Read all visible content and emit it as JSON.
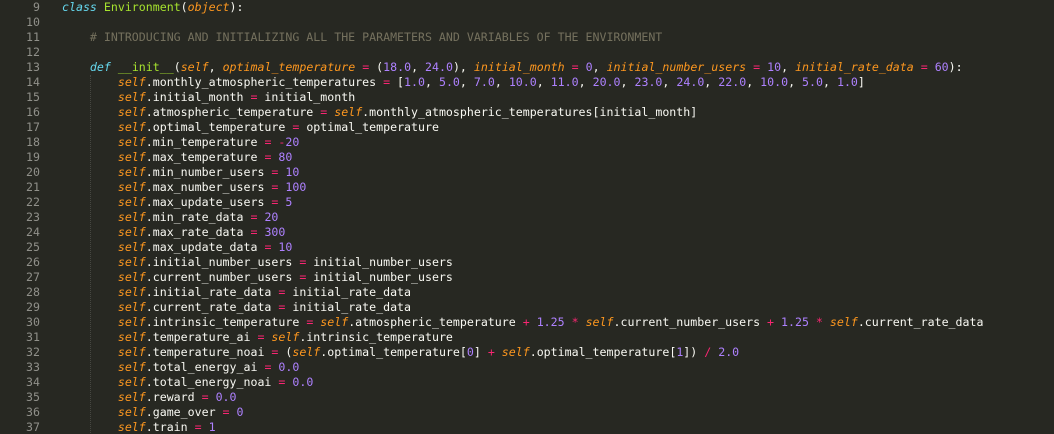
{
  "editor": {
    "first_line_number": 9,
    "lines": [
      {
        "n": "9",
        "tokens": [
          [
            "kw-i",
            "class"
          ],
          [
            "plain",
            " "
          ],
          [
            "cls",
            "Environment"
          ],
          [
            "plain",
            "("
          ],
          [
            "param",
            "object"
          ],
          [
            "plain",
            "):"
          ]
        ]
      },
      {
        "n": "10",
        "tokens": []
      },
      {
        "n": "11",
        "tokens": [
          [
            "plain",
            "    "
          ],
          [
            "cmt",
            "# INTRODUCING AND INITIALIZING ALL THE PARAMETERS AND VARIABLES OF THE ENVIRONMENT"
          ]
        ]
      },
      {
        "n": "12",
        "tokens": []
      },
      {
        "n": "13",
        "tokens": [
          [
            "plain",
            "    "
          ],
          [
            "kw-i",
            "def"
          ],
          [
            "plain",
            " "
          ],
          [
            "fn",
            "__init__"
          ],
          [
            "plain",
            "("
          ],
          [
            "param",
            "self"
          ],
          [
            "plain",
            ", "
          ],
          [
            "param",
            "optimal_temperature"
          ],
          [
            "plain",
            " "
          ],
          [
            "op",
            "="
          ],
          [
            "plain",
            " ("
          ],
          [
            "num",
            "18.0"
          ],
          [
            "plain",
            ", "
          ],
          [
            "num",
            "24.0"
          ],
          [
            "plain",
            "), "
          ],
          [
            "param",
            "initial_month"
          ],
          [
            "plain",
            " "
          ],
          [
            "op",
            "="
          ],
          [
            "plain",
            " "
          ],
          [
            "num",
            "0"
          ],
          [
            "plain",
            ", "
          ],
          [
            "param",
            "initial_number_users"
          ],
          [
            "plain",
            " "
          ],
          [
            "op",
            "="
          ],
          [
            "plain",
            " "
          ],
          [
            "num",
            "10"
          ],
          [
            "plain",
            ", "
          ],
          [
            "param",
            "initial_rate_data"
          ],
          [
            "plain",
            " "
          ],
          [
            "op",
            "="
          ],
          [
            "plain",
            " "
          ],
          [
            "num",
            "60"
          ],
          [
            "plain",
            "):"
          ]
        ]
      },
      {
        "n": "14",
        "tokens": [
          [
            "plain",
            "        "
          ],
          [
            "self",
            "self"
          ],
          [
            "plain",
            ".monthly_atmospheric_temperatures "
          ],
          [
            "op",
            "="
          ],
          [
            "plain",
            " ["
          ],
          [
            "num",
            "1.0"
          ],
          [
            "plain",
            ", "
          ],
          [
            "num",
            "5.0"
          ],
          [
            "plain",
            ", "
          ],
          [
            "num",
            "7.0"
          ],
          [
            "plain",
            ", "
          ],
          [
            "num",
            "10.0"
          ],
          [
            "plain",
            ", "
          ],
          [
            "num",
            "11.0"
          ],
          [
            "plain",
            ", "
          ],
          [
            "num",
            "20.0"
          ],
          [
            "plain",
            ", "
          ],
          [
            "num",
            "23.0"
          ],
          [
            "plain",
            ", "
          ],
          [
            "num",
            "24.0"
          ],
          [
            "plain",
            ", "
          ],
          [
            "num",
            "22.0"
          ],
          [
            "plain",
            ", "
          ],
          [
            "num",
            "10.0"
          ],
          [
            "plain",
            ", "
          ],
          [
            "num",
            "5.0"
          ],
          [
            "plain",
            ", "
          ],
          [
            "num",
            "1.0"
          ],
          [
            "plain",
            "]"
          ]
        ]
      },
      {
        "n": "15",
        "tokens": [
          [
            "plain",
            "        "
          ],
          [
            "self",
            "self"
          ],
          [
            "plain",
            ".initial_month "
          ],
          [
            "op",
            "="
          ],
          [
            "plain",
            " initial_month"
          ]
        ]
      },
      {
        "n": "16",
        "tokens": [
          [
            "plain",
            "        "
          ],
          [
            "self",
            "self"
          ],
          [
            "plain",
            ".atmospheric_temperature "
          ],
          [
            "op",
            "="
          ],
          [
            "plain",
            " "
          ],
          [
            "self",
            "self"
          ],
          [
            "plain",
            ".monthly_atmospheric_temperatures[initial_month]"
          ]
        ]
      },
      {
        "n": "17",
        "tokens": [
          [
            "plain",
            "        "
          ],
          [
            "self",
            "self"
          ],
          [
            "plain",
            ".optimal_temperature "
          ],
          [
            "op",
            "="
          ],
          [
            "plain",
            " optimal_temperature"
          ]
        ]
      },
      {
        "n": "18",
        "tokens": [
          [
            "plain",
            "        "
          ],
          [
            "self",
            "self"
          ],
          [
            "plain",
            ".min_temperature "
          ],
          [
            "op",
            "="
          ],
          [
            "plain",
            " "
          ],
          [
            "op",
            "-"
          ],
          [
            "num",
            "20"
          ]
        ]
      },
      {
        "n": "19",
        "tokens": [
          [
            "plain",
            "        "
          ],
          [
            "self",
            "self"
          ],
          [
            "plain",
            ".max_temperature "
          ],
          [
            "op",
            "="
          ],
          [
            "plain",
            " "
          ],
          [
            "num",
            "80"
          ]
        ]
      },
      {
        "n": "20",
        "tokens": [
          [
            "plain",
            "        "
          ],
          [
            "self",
            "self"
          ],
          [
            "plain",
            ".min_number_users "
          ],
          [
            "op",
            "="
          ],
          [
            "plain",
            " "
          ],
          [
            "num",
            "10"
          ]
        ]
      },
      {
        "n": "21",
        "tokens": [
          [
            "plain",
            "        "
          ],
          [
            "self",
            "self"
          ],
          [
            "plain",
            ".max_number_users "
          ],
          [
            "op",
            "="
          ],
          [
            "plain",
            " "
          ],
          [
            "num",
            "100"
          ]
        ]
      },
      {
        "n": "22",
        "tokens": [
          [
            "plain",
            "        "
          ],
          [
            "self",
            "self"
          ],
          [
            "plain",
            ".max_update_users "
          ],
          [
            "op",
            "="
          ],
          [
            "plain",
            " "
          ],
          [
            "num",
            "5"
          ]
        ]
      },
      {
        "n": "23",
        "tokens": [
          [
            "plain",
            "        "
          ],
          [
            "self",
            "self"
          ],
          [
            "plain",
            ".min_rate_data "
          ],
          [
            "op",
            "="
          ],
          [
            "plain",
            " "
          ],
          [
            "num",
            "20"
          ]
        ]
      },
      {
        "n": "24",
        "tokens": [
          [
            "plain",
            "        "
          ],
          [
            "self",
            "self"
          ],
          [
            "plain",
            ".max_rate_data "
          ],
          [
            "op",
            "="
          ],
          [
            "plain",
            " "
          ],
          [
            "num",
            "300"
          ]
        ]
      },
      {
        "n": "25",
        "tokens": [
          [
            "plain",
            "        "
          ],
          [
            "self",
            "self"
          ],
          [
            "plain",
            ".max_update_data "
          ],
          [
            "op",
            "="
          ],
          [
            "plain",
            " "
          ],
          [
            "num",
            "10"
          ]
        ]
      },
      {
        "n": "26",
        "tokens": [
          [
            "plain",
            "        "
          ],
          [
            "self",
            "self"
          ],
          [
            "plain",
            ".initial_number_users "
          ],
          [
            "op",
            "="
          ],
          [
            "plain",
            " initial_number_users"
          ]
        ]
      },
      {
        "n": "27",
        "tokens": [
          [
            "plain",
            "        "
          ],
          [
            "self",
            "self"
          ],
          [
            "plain",
            ".current_number_users "
          ],
          [
            "op",
            "="
          ],
          [
            "plain",
            " initial_number_users"
          ]
        ]
      },
      {
        "n": "28",
        "tokens": [
          [
            "plain",
            "        "
          ],
          [
            "self",
            "self"
          ],
          [
            "plain",
            ".initial_rate_data "
          ],
          [
            "op",
            "="
          ],
          [
            "plain",
            " initial_rate_data"
          ]
        ]
      },
      {
        "n": "29",
        "tokens": [
          [
            "plain",
            "        "
          ],
          [
            "self",
            "self"
          ],
          [
            "plain",
            ".current_rate_data "
          ],
          [
            "op",
            "="
          ],
          [
            "plain",
            " initial_rate_data"
          ]
        ]
      },
      {
        "n": "30",
        "tokens": [
          [
            "plain",
            "        "
          ],
          [
            "self",
            "self"
          ],
          [
            "plain",
            ".intrinsic_temperature "
          ],
          [
            "op",
            "="
          ],
          [
            "plain",
            " "
          ],
          [
            "self",
            "self"
          ],
          [
            "plain",
            ".atmospheric_temperature "
          ],
          [
            "op",
            "+"
          ],
          [
            "plain",
            " "
          ],
          [
            "num",
            "1.25"
          ],
          [
            "plain",
            " "
          ],
          [
            "op",
            "*"
          ],
          [
            "plain",
            " "
          ],
          [
            "self",
            "self"
          ],
          [
            "plain",
            ".current_number_users "
          ],
          [
            "op",
            "+"
          ],
          [
            "plain",
            " "
          ],
          [
            "num",
            "1.25"
          ],
          [
            "plain",
            " "
          ],
          [
            "op",
            "*"
          ],
          [
            "plain",
            " "
          ],
          [
            "self",
            "self"
          ],
          [
            "plain",
            ".current_rate_data"
          ]
        ]
      },
      {
        "n": "31",
        "tokens": [
          [
            "plain",
            "        "
          ],
          [
            "self",
            "self"
          ],
          [
            "plain",
            ".temperature_ai "
          ],
          [
            "op",
            "="
          ],
          [
            "plain",
            " "
          ],
          [
            "self",
            "self"
          ],
          [
            "plain",
            ".intrinsic_temperature"
          ]
        ]
      },
      {
        "n": "32",
        "tokens": [
          [
            "plain",
            "        "
          ],
          [
            "self",
            "self"
          ],
          [
            "plain",
            ".temperature_noai "
          ],
          [
            "op",
            "="
          ],
          [
            "plain",
            " ("
          ],
          [
            "self",
            "self"
          ],
          [
            "plain",
            ".optimal_temperature["
          ],
          [
            "num",
            "0"
          ],
          [
            "plain",
            "] "
          ],
          [
            "op",
            "+"
          ],
          [
            "plain",
            " "
          ],
          [
            "self",
            "self"
          ],
          [
            "plain",
            ".optimal_temperature["
          ],
          [
            "num",
            "1"
          ],
          [
            "plain",
            "]) "
          ],
          [
            "op",
            "/"
          ],
          [
            "plain",
            " "
          ],
          [
            "num",
            "2.0"
          ]
        ]
      },
      {
        "n": "33",
        "tokens": [
          [
            "plain",
            "        "
          ],
          [
            "self",
            "self"
          ],
          [
            "plain",
            ".total_energy_ai "
          ],
          [
            "op",
            "="
          ],
          [
            "plain",
            " "
          ],
          [
            "num",
            "0.0"
          ]
        ]
      },
      {
        "n": "34",
        "tokens": [
          [
            "plain",
            "        "
          ],
          [
            "self",
            "self"
          ],
          [
            "plain",
            ".total_energy_noai "
          ],
          [
            "op",
            "="
          ],
          [
            "plain",
            " "
          ],
          [
            "num",
            "0.0"
          ]
        ]
      },
      {
        "n": "35",
        "tokens": [
          [
            "plain",
            "        "
          ],
          [
            "self",
            "self"
          ],
          [
            "plain",
            ".reward "
          ],
          [
            "op",
            "="
          ],
          [
            "plain",
            " "
          ],
          [
            "num",
            "0.0"
          ]
        ]
      },
      {
        "n": "36",
        "tokens": [
          [
            "plain",
            "        "
          ],
          [
            "self",
            "self"
          ],
          [
            "plain",
            ".game_over "
          ],
          [
            "op",
            "="
          ],
          [
            "plain",
            " "
          ],
          [
            "num",
            "0"
          ]
        ]
      },
      {
        "n": "37",
        "tokens": [
          [
            "plain",
            "        "
          ],
          [
            "self",
            "self"
          ],
          [
            "plain",
            ".train "
          ],
          [
            "op",
            "="
          ],
          [
            "plain",
            " "
          ],
          [
            "num",
            "1"
          ]
        ]
      }
    ]
  }
}
